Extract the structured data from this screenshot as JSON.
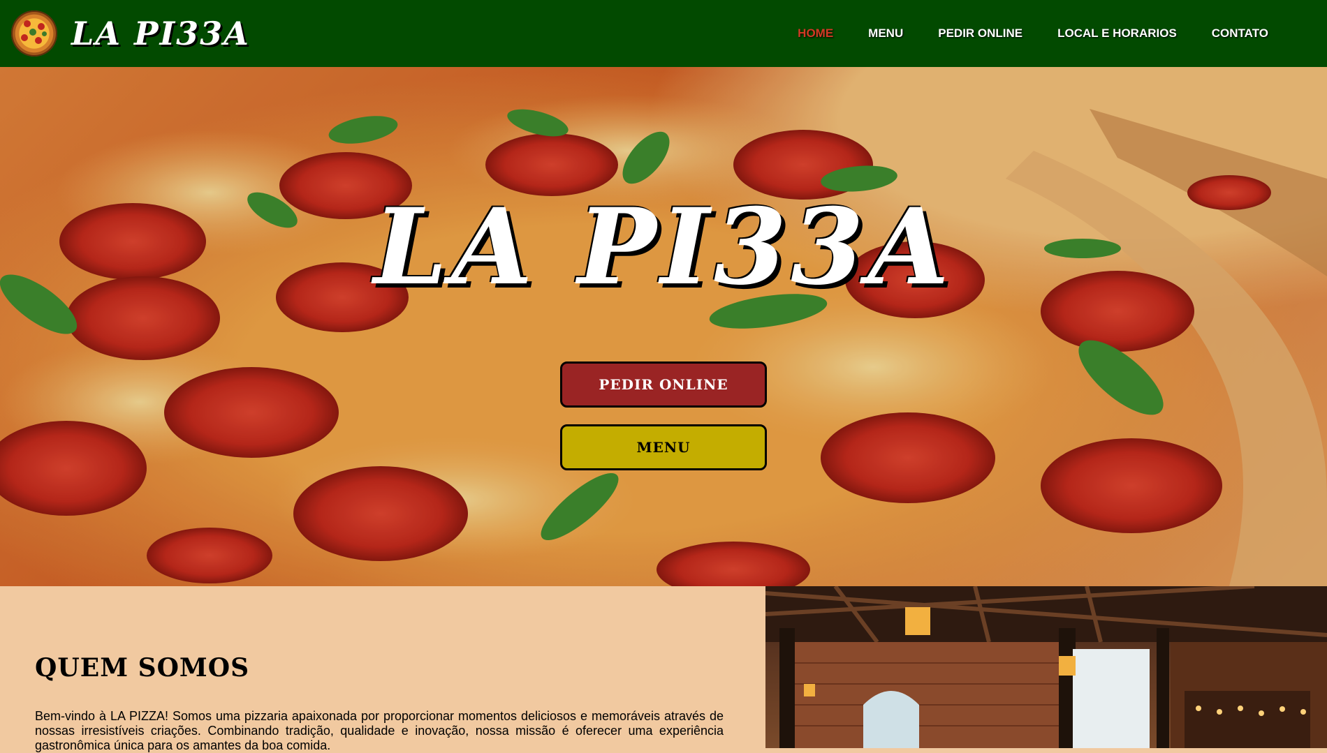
{
  "brand": {
    "name": "LA PI33A",
    "logo_icon": "pizza-logo-icon"
  },
  "nav": {
    "items": [
      {
        "label": "HOME",
        "active": true
      },
      {
        "label": "MENU",
        "active": false
      },
      {
        "label": "PEDIR ONLINE",
        "active": false
      },
      {
        "label": "LOCAL E HORARIOS",
        "active": false
      },
      {
        "label": "CONTATO",
        "active": false
      }
    ]
  },
  "hero": {
    "title": "LA PI33A",
    "order_button": "PEDIR ONLINE",
    "menu_button": "MENU",
    "background": "pizza-photo"
  },
  "about": {
    "title": "QUEM SOMOS",
    "text": "Bem-vindo à LA PIZZA! Somos uma pizzaria apaixonada por proporcionar momentos deliciosos e memoráveis através de nossas irresistíveis criações. Combinando tradição, qualidade e inovação, nossa missão é oferecer uma experiência gastronômica única para os amantes da boa comida.",
    "photo": "restaurant-interior-photo"
  },
  "colors": {
    "navbar": "#024a00",
    "active_link": "#d23a24",
    "order_button": "#9a2424",
    "menu_button": "#c4ad00",
    "about_bg": "#f1c9a0"
  }
}
